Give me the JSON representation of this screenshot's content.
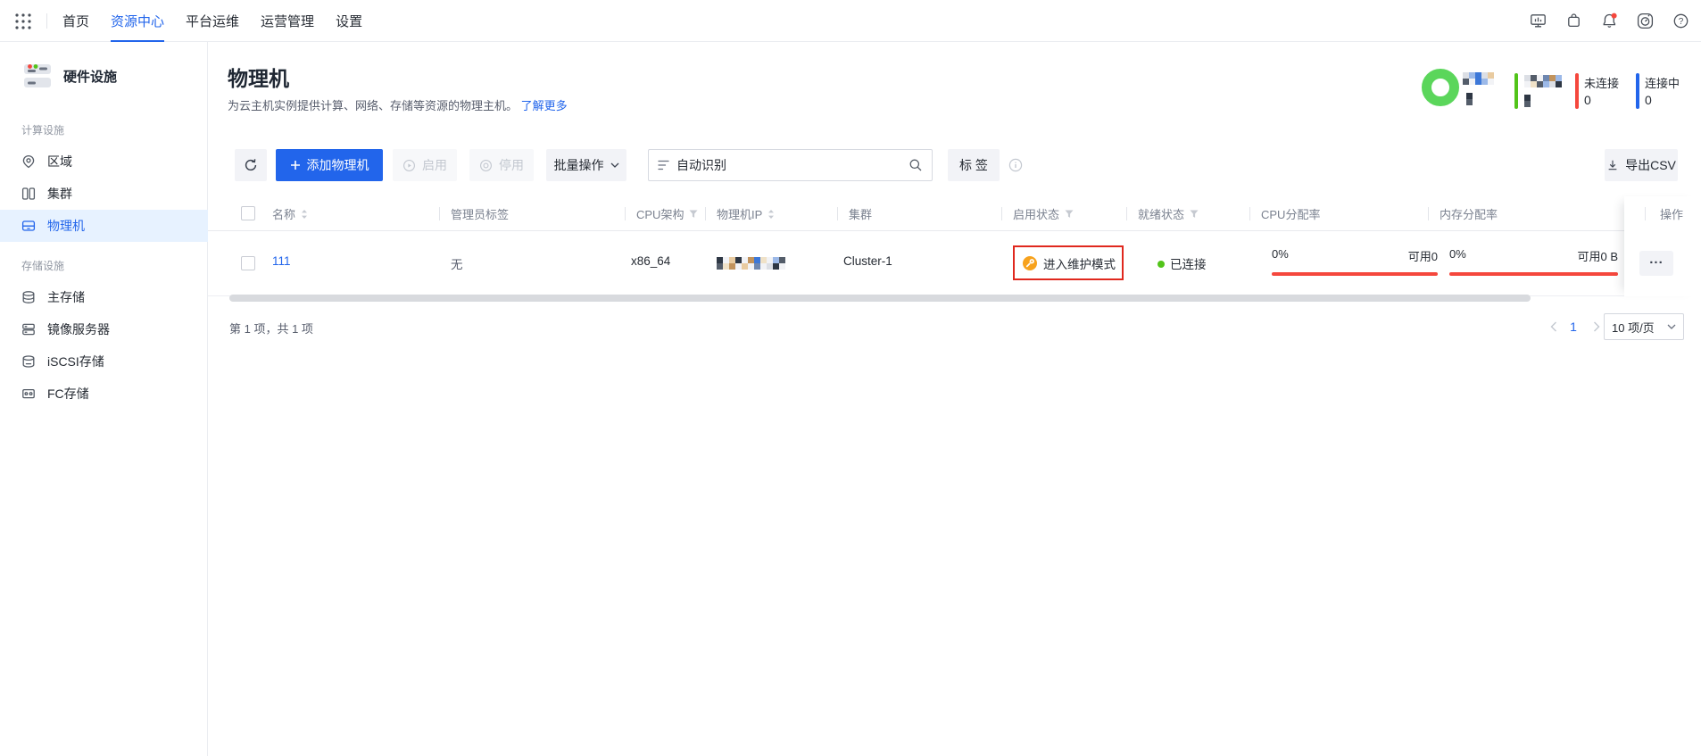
{
  "colors": {
    "accent": "#2265eb",
    "danger": "#f5473d",
    "warning": "#f7a21d",
    "success": "#52c41a",
    "donut_green": "#5bd65b",
    "annotation_red": "#e0281e"
  },
  "topnav": {
    "items": [
      "首页",
      "资源中心",
      "平台运维",
      "运营管理",
      "设置"
    ],
    "active": "资源中心"
  },
  "sidebar": {
    "title": "硬件设施",
    "sections": [
      {
        "label": "计算设施",
        "items": [
          {
            "label": "区域"
          },
          {
            "label": "集群"
          },
          {
            "label": "物理机",
            "selected": true
          }
        ]
      },
      {
        "label": "存储设施",
        "items": [
          {
            "label": "主存储"
          },
          {
            "label": "镜像服务器"
          },
          {
            "label": "iSCSI存储"
          },
          {
            "label": "FC存储"
          }
        ]
      }
    ]
  },
  "header": {
    "title": "物理机",
    "subtitle": "为云主机实例提供计算、网络、存储等资源的物理主机。",
    "learn_more": "了解更多"
  },
  "stats": {
    "not_connected": {
      "label": "未连接",
      "value": "0"
    },
    "connecting": {
      "label": "连接中",
      "value": "0"
    }
  },
  "toolbar": {
    "add_label": "添加物理机",
    "enable_label": "启用",
    "disable_label": "停用",
    "batch_label": "批量操作",
    "search_placeholder": "自动识别",
    "tag_label": "标 签",
    "export_label": "导出CSV"
  },
  "table": {
    "columns": [
      "名称",
      "管理员标签",
      "CPU架构",
      "物理机IP",
      "集群",
      "启用状态",
      "就绪状态",
      "CPU分配率",
      "内存分配率",
      "操作"
    ],
    "row": {
      "name": "111",
      "admin_tag": "无",
      "cpu_arch": "x86_64",
      "cluster": "Cluster-1",
      "enable_status": "进入维护模式",
      "ready_status": "已连接",
      "cpu_alloc": {
        "percent": "0%",
        "available": "可用0"
      },
      "mem_alloc": {
        "percent": "0%",
        "available": "可用0 B"
      },
      "more_label": "..."
    }
  },
  "footer": {
    "summary": "第 1 项，共 1 项",
    "page": "1",
    "page_size": "10 项/页"
  }
}
